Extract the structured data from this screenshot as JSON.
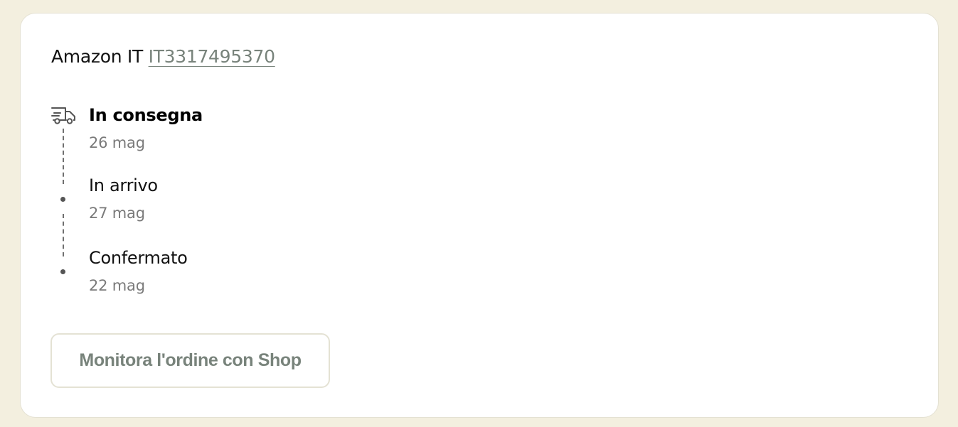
{
  "colors": {
    "page_background": "#f3efdf",
    "card_background": "#ffffff",
    "accent_muted": "#78837b",
    "text_primary": "#111111",
    "text_secondary": "#7a7a7a"
  },
  "order": {
    "carrier": "Amazon IT",
    "tracking_number": "IT3317495370"
  },
  "timeline": {
    "steps": [
      {
        "title": "In consegna",
        "date": "26 mag",
        "icon": "truck-icon",
        "active": true
      },
      {
        "title": "In arrivo",
        "date": "27 mag",
        "icon": "dot-icon",
        "active": false
      },
      {
        "title": "Confermato",
        "date": "22 mag",
        "icon": "dot-icon",
        "active": false
      }
    ]
  },
  "actions": {
    "track_button_label": "Monitora l'ordine con Shop"
  }
}
